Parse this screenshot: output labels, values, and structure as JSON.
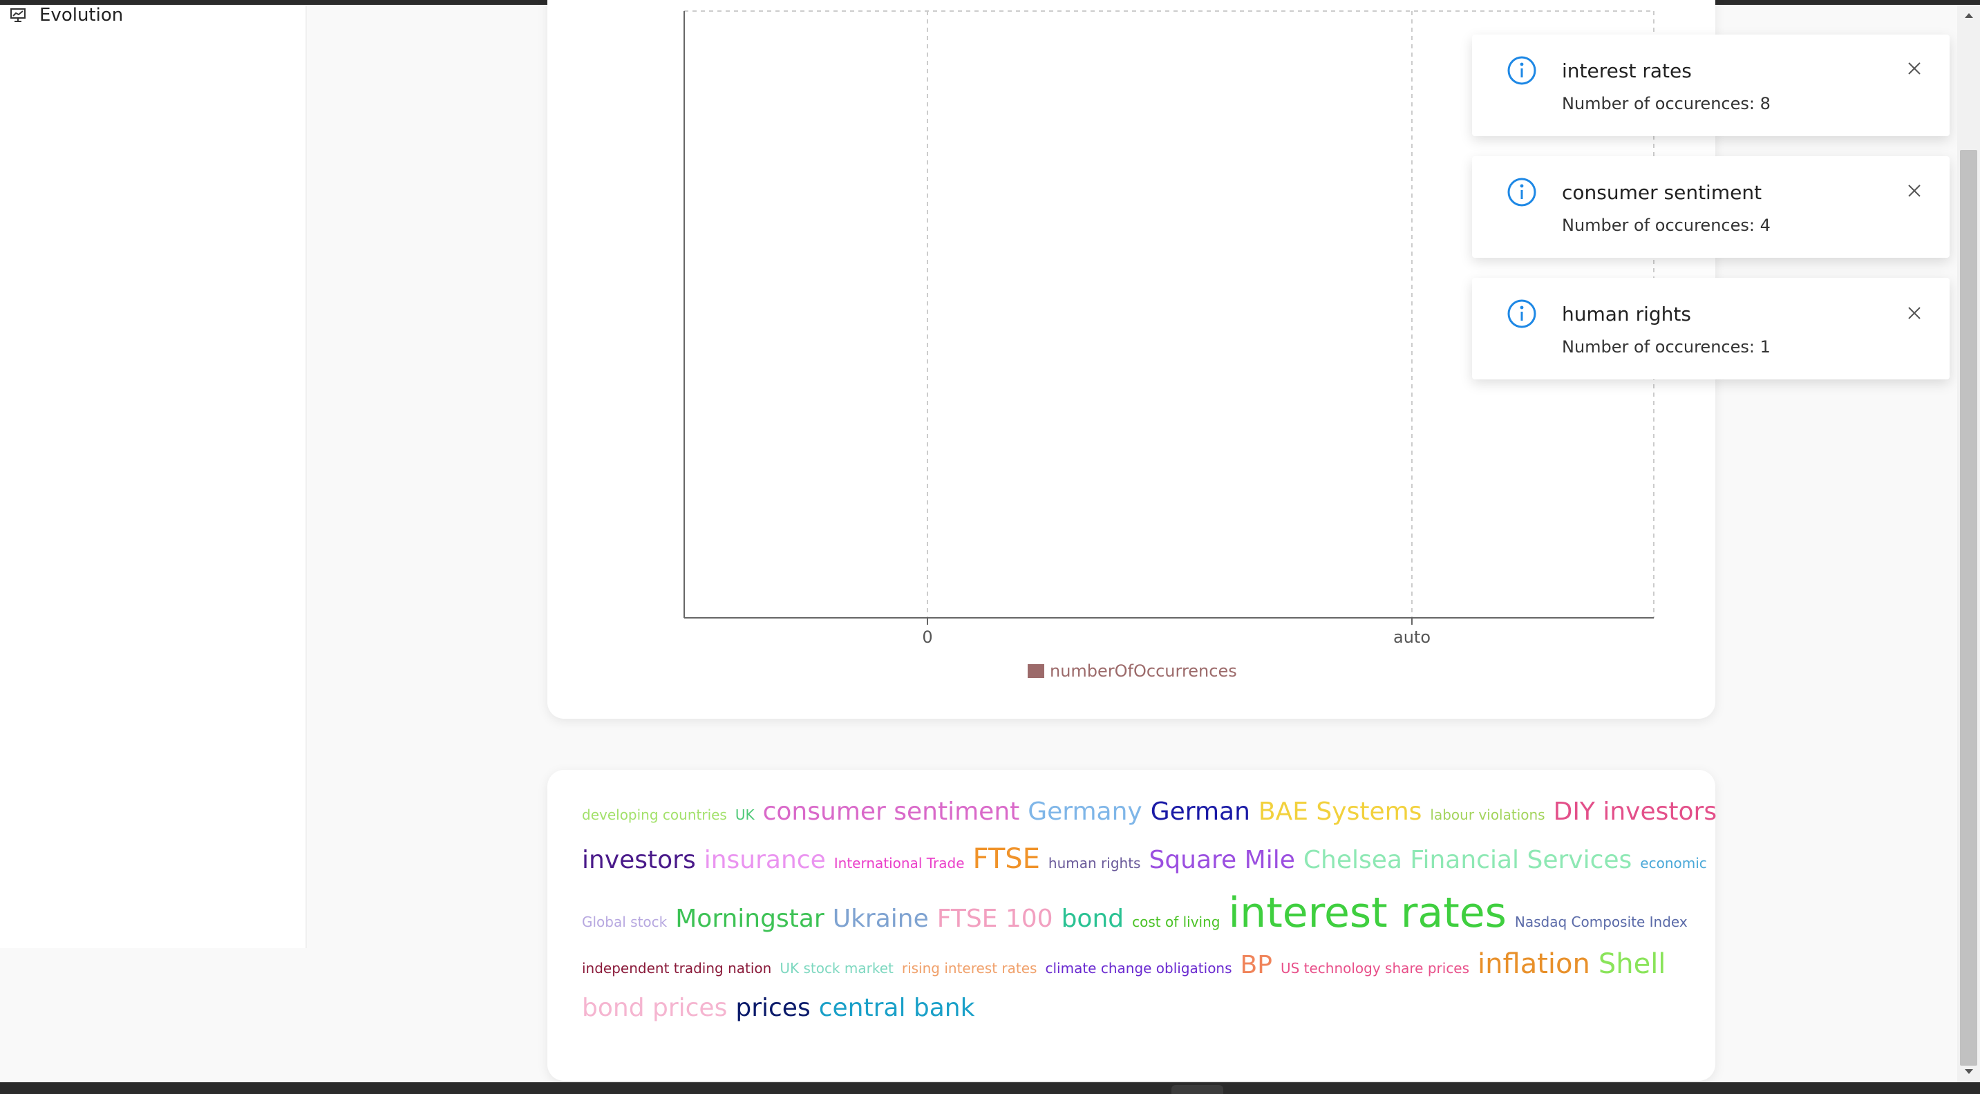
{
  "sidebar": {
    "item": {
      "label": "Evolution",
      "icon": "presentation-chart-icon"
    }
  },
  "chart_data": {
    "type": "bar",
    "orientation": "horizontal",
    "categories": [],
    "series": [
      {
        "name": "numberOfOccurrences",
        "values": [],
        "color": "#9c6a6a"
      }
    ],
    "x_ticks": [
      "0",
      "auto"
    ],
    "grid": true,
    "legend": "bottom"
  },
  "toasts": [
    {
      "title": "interest rates",
      "body": "Number of occurences: 8"
    },
    {
      "title": "consumer sentiment",
      "body": "Number of occurences: 4"
    },
    {
      "title": "human rights",
      "body": "Number of occurences: 1"
    }
  ],
  "colors": {
    "info": "#1e88e5",
    "legend": "#9c6a6a"
  },
  "word_cloud": {
    "rows": [
      [
        {
          "text": "developing countries",
          "size": 20,
          "color": "#a3e16b"
        },
        {
          "text": "UK",
          "size": 20,
          "color": "#4fc978"
        },
        {
          "text": "consumer sentiment",
          "size": 36,
          "color": "#d969c9"
        },
        {
          "text": "Germany",
          "size": 36,
          "color": "#7fb6e8"
        },
        {
          "text": "German",
          "size": 36,
          "color": "#1a1aa6"
        },
        {
          "text": "BAE Systems",
          "size": 36,
          "color": "#f2d13d"
        },
        {
          "text": "labour violations",
          "size": 20,
          "color": "#a3d45c"
        },
        {
          "text": "DIY investors",
          "size": 36,
          "color": "#e3508a"
        }
      ],
      [
        {
          "text": "investors",
          "size": 36,
          "color": "#4a1a8a"
        },
        {
          "text": "insurance",
          "size": 36,
          "color": "#ea94f0"
        },
        {
          "text": "International Trade",
          "size": 20,
          "color": "#ea3fc9"
        },
        {
          "text": "FTSE",
          "size": 40,
          "color": "#f0932a"
        },
        {
          "text": "human rights",
          "size": 20,
          "color": "#6a5a9a"
        },
        {
          "text": "Square Mile",
          "size": 36,
          "color": "#9b4fe0"
        },
        {
          "text": "Chelsea Financial Services",
          "size": 36,
          "color": "#8ee8b4"
        },
        {
          "text": "economic",
          "size": 20,
          "color": "#4aa8d8"
        }
      ],
      [
        {
          "text": "Global stock",
          "size": 20,
          "color": "#b7a8e0"
        },
        {
          "text": "Morningstar",
          "size": 36,
          "color": "#3dc255"
        },
        {
          "text": "Ukraine",
          "size": 36,
          "color": "#7fa3d1"
        },
        {
          "text": "FTSE 100",
          "size": 36,
          "color": "#f2a0c0"
        },
        {
          "text": "bond",
          "size": 36,
          "color": "#2ac293"
        },
        {
          "text": "cost of living",
          "size": 20,
          "color": "#4ac225"
        },
        {
          "text": "interest rates",
          "size": 60,
          "color": "#3fcf3f"
        },
        {
          "text": "Nasdaq Composite Index",
          "size": 20,
          "color": "#5a6aa8"
        }
      ],
      [
        {
          "text": "independent trading nation",
          "size": 20,
          "color": "#8a1a3a"
        },
        {
          "text": "UK stock market",
          "size": 20,
          "color": "#7ed8c0"
        },
        {
          "text": "rising interest rates",
          "size": 20,
          "color": "#f0a06a"
        },
        {
          "text": "climate change obligations",
          "size": 20,
          "color": "#6a2ad0"
        },
        {
          "text": "BP",
          "size": 36,
          "color": "#f0845a"
        },
        {
          "text": "US technology share prices",
          "size": 20,
          "color": "#e8508a"
        },
        {
          "text": "inflation",
          "size": 40,
          "color": "#e8902a"
        },
        {
          "text": "Shell",
          "size": 40,
          "color": "#8ae45a"
        }
      ],
      [
        {
          "text": "bond prices",
          "size": 36,
          "color": "#f5b5d0"
        },
        {
          "text": "prices",
          "size": 36,
          "color": "#0a1a6a"
        },
        {
          "text": "central bank",
          "size": 36,
          "color": "#1aa0c8"
        }
      ]
    ]
  }
}
